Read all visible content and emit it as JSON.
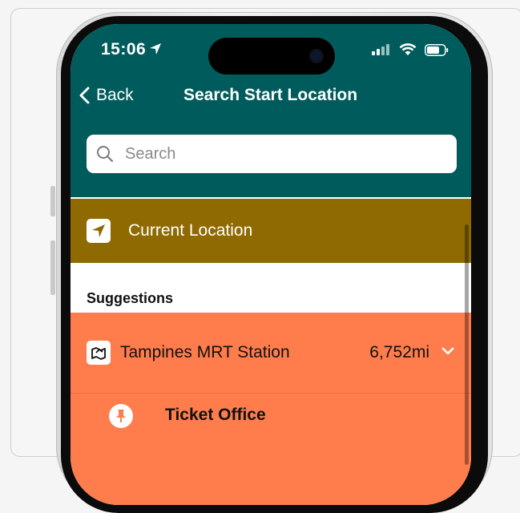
{
  "status_bar": {
    "time": "15:06"
  },
  "nav": {
    "back_label": "Back",
    "title": "Search Start Location"
  },
  "search": {
    "placeholder": "Search",
    "value": ""
  },
  "current_location": {
    "label": "Current Location",
    "icon": "location-arrow-icon"
  },
  "suggestions": {
    "heading": "Suggestions",
    "items": [
      {
        "name": "Tampines MRT Station",
        "distance": "6,752mi",
        "icon": "map-icon",
        "expanded": true,
        "children": [
          {
            "name": "Ticket Office",
            "icon": "pin-icon"
          }
        ]
      }
    ]
  },
  "colors": {
    "header": "#005c5c",
    "current_location_bg": "#8e6a00",
    "suggestion_bg": "#ff7d4c"
  }
}
